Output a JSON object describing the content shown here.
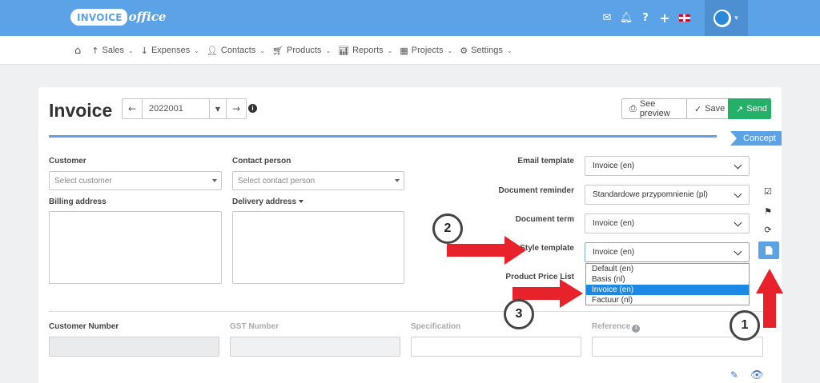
{
  "header": {
    "logo_main": "INVOICE",
    "logo_sub": "office",
    "icons": [
      "mail-icon",
      "bell-icon",
      "help-icon",
      "plus-icon",
      "uk-flag-icon",
      "avatar-icon"
    ],
    "help_glyph": "?",
    "plus_glyph": "+"
  },
  "nav": {
    "items": [
      {
        "label": "",
        "icon": "home-icon"
      },
      {
        "label": "Sales",
        "icon": "arrow-up-icon"
      },
      {
        "label": "Expenses",
        "icon": "arrow-down-icon"
      },
      {
        "label": "Contacts",
        "icon": "user-icon"
      },
      {
        "label": "Products",
        "icon": "cart-icon"
      },
      {
        "label": "Reports",
        "icon": "bar-chart-icon"
      },
      {
        "label": "Projects",
        "icon": "calendar-icon"
      },
      {
        "label": "Settings",
        "icon": "gear-icon"
      }
    ]
  },
  "page": {
    "title": "Invoice",
    "number": "2022001",
    "status": "Concept"
  },
  "toolbar": {
    "preview_label": "See preview",
    "save_label": "Save",
    "send_label": "Send"
  },
  "form": {
    "customer_label": "Customer",
    "customer_placeholder": "Select customer",
    "contact_label": "Contact person",
    "contact_placeholder": "Select contact person",
    "billing_label": "Billing address",
    "delivery_label": "Delivery address",
    "email_template_label": "Email template",
    "email_template_value": "Invoice (en)",
    "reminder_label": "Document reminder",
    "reminder_value": "Standardowe przypomnienie (pl)",
    "term_label": "Document term",
    "term_value": "Invoice (en)",
    "style_label": "Style template",
    "style_value": "Invoice (en)",
    "style_options": [
      "Default (en)",
      "Basis (nl)",
      "Invoice (en)",
      "Factuur (nl)"
    ],
    "style_selected_index": 2,
    "price_list_label": "Product Price List",
    "customer_number_label": "Customer Number",
    "gst_label": "GST Number",
    "specification_label": "Specification",
    "reference_label": "Reference"
  },
  "annotations": {
    "step1": "1",
    "step2": "2",
    "step3": "3",
    "arrow_color": "#e8222a"
  },
  "colors": {
    "brand": "#5ba3e6",
    "send": "#25b06a",
    "selected_option": "#1e88e5"
  }
}
